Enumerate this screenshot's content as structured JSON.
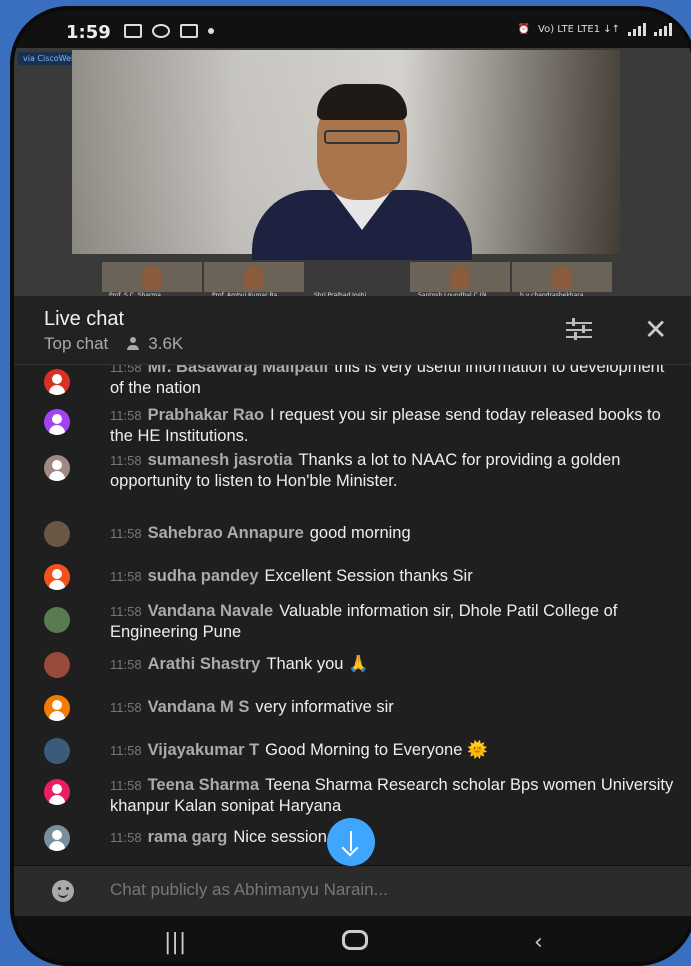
{
  "status_bar": {
    "time": "1:59",
    "network": "Vo) LTE LTE1 ↓↑"
  },
  "video": {
    "webex_badge": "via CiscoWebex",
    "thumbnails": [
      "Prof. S.C. Sharma",
      "Prof. Ambuj Kumar Ra",
      "Shri Pralhad Joshi",
      "Santosh Loundhal C (N",
      "h.v chandrashekhara"
    ]
  },
  "header": {
    "title": "Live chat",
    "subtitle": "Top chat",
    "viewers": "3.6K"
  },
  "messages": [
    {
      "time": "11:58",
      "author": "Mr. Basawaraj Malipatil",
      "text": "this is very useful information to development of the nation"
    },
    {
      "time": "11:58",
      "author": "Prabhakar Rao",
      "text": "I request you sir please send today released books to the HE Institutions."
    },
    {
      "time": "11:58",
      "author": "sumanesh jasrotia",
      "text": "Thanks a lot to NAAC for providing a golden opportunity to listen to Hon'ble Minister."
    },
    {
      "time": "11:58",
      "author": "Sahebrao Annapure",
      "text": "good morning"
    },
    {
      "time": "11:58",
      "author": "sudha pandey",
      "text": "Excellent Session thanks Sir"
    },
    {
      "time": "11:58",
      "author": "Vandana Navale",
      "text": "Valuable information sir, Dhole Patil College of Engineering Pune"
    },
    {
      "time": "11:58",
      "author": "Arathi Shastry",
      "text": "Thank you 🙏"
    },
    {
      "time": "11:58",
      "author": "Vandana M S",
      "text": "very informative sir"
    },
    {
      "time": "11:58",
      "author": "Vijayakumar T",
      "text": "Good Morning to Everyone 🌞"
    },
    {
      "time": "11:58",
      "author": "Teena Sharma",
      "text": "Teena Sharma Research scholar Bps women University khanpur Kalan sonipat Haryana"
    },
    {
      "time": "11:58",
      "author": "rama garg",
      "text": "Nice session"
    }
  ],
  "avatar_colors": [
    "#d93025",
    "#a142f4",
    "#9e8a80",
    "#6a5844",
    "#f4511e",
    "#5a7a50",
    "#9a4a3a",
    "#f57c00",
    "#3c5a7a",
    "#e91e63",
    "#78909c"
  ],
  "input": {
    "placeholder": "Chat publicly as Abhimanyu Narain..."
  },
  "accent_color": "#3ea6ff"
}
